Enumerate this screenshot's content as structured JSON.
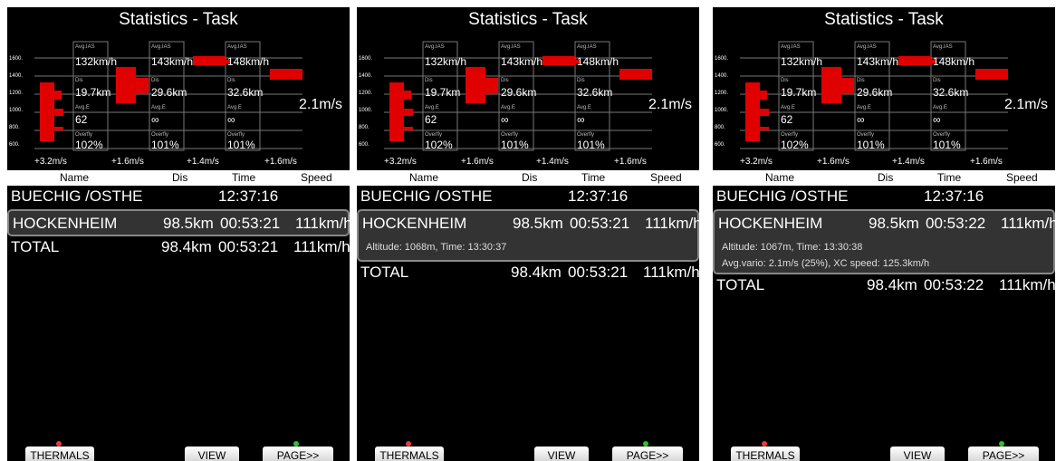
{
  "screen_title": "Statistics - Task",
  "chart_labels": {
    "y_ticks": [
      "1600.",
      "1400.",
      "1200.",
      "1000.",
      "800.",
      "600."
    ],
    "avg_ias_label": "Avg.IAS",
    "dis_label": "Dis",
    "avg_e_label": "Avg.E",
    "overfly_label": "Overfly",
    "avg_ias_values": [
      "132km/h",
      "143km/h",
      "148km/h"
    ],
    "dis_values": [
      "19.7km",
      "29.6km",
      "32.6km"
    ],
    "avg_e_values": [
      "62",
      "∞",
      "∞"
    ],
    "overfly_values": [
      "102%",
      "101%",
      "101%"
    ],
    "bottom_vario": [
      "+3.2m/s",
      "+1.6m/s",
      "+1.4m/s",
      "+1.6m/s"
    ],
    "current_vario": "2.1m/s"
  },
  "table_header": {
    "name": "Name",
    "dis": "Dis",
    "time": "Time",
    "speed": "Speed"
  },
  "panels": [
    {
      "rows": [
        {
          "name": "BUECHIG /OSTHE",
          "dis": "",
          "time": "12:37:16",
          "speed": ""
        },
        {
          "name": "HOCKENHEIM",
          "dis": "98.5km",
          "time": "00:53:21",
          "speed": "111km/h"
        },
        {
          "name": "TOTAL",
          "dis": "98.4km",
          "time": "00:53:21",
          "speed": "111km/h"
        }
      ],
      "details": []
    },
    {
      "rows": [
        {
          "name": "BUECHIG /OSTHE",
          "dis": "",
          "time": "12:37:16",
          "speed": ""
        },
        {
          "name": "HOCKENHEIM",
          "dis": "98.5km",
          "time": "00:53:21",
          "speed": "111km/h"
        },
        {
          "name": "TOTAL",
          "dis": "98.4km",
          "time": "00:53:21",
          "speed": "111km/h"
        }
      ],
      "details": [
        "Altitude: 1068m, Time: 13:30:37"
      ]
    },
    {
      "rows": [
        {
          "name": "BUECHIG /OSTHE",
          "dis": "",
          "time": "12:37:16",
          "speed": ""
        },
        {
          "name": "HOCKENHEIM",
          "dis": "98.5km",
          "time": "00:53:22",
          "speed": "111km/h"
        },
        {
          "name": "TOTAL",
          "dis": "98.4km",
          "time": "00:53:22",
          "speed": "111km/h"
        }
      ],
      "details": [
        "Altitude: 1067m, Time: 13:30:38",
        "Avg.vario: 2.1m/s (25%), XC speed: 125.3km/h"
      ]
    }
  ],
  "buttons": {
    "thermals": "THERMALS",
    "view": "VIEW",
    "page": "PAGE>>"
  },
  "colors": {
    "histogram": "#e10000",
    "led_red": "#e63c3c",
    "led_green": "#2fc12f"
  }
}
